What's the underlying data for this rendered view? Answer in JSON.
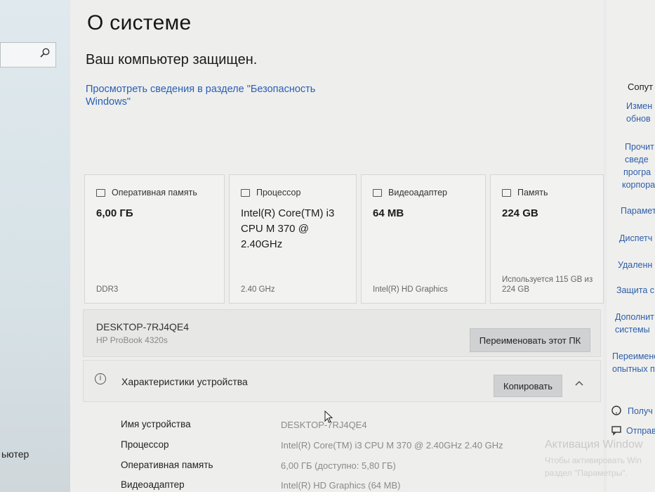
{
  "sidebar": {
    "partial_label": "ьютер"
  },
  "header": {
    "title": "О системе"
  },
  "security": {
    "status": "Ваш компьютер защищен.",
    "link": "Просмотреть сведения в разделе \"Безопасность Windows\""
  },
  "cards": [
    {
      "title": "Оперативная память",
      "icon": "memory-icon",
      "value": "6,00 ГБ",
      "footer": "DDR3"
    },
    {
      "title": "Процессор",
      "icon": "processor-icon",
      "value": "Intel(R) Core(TM) i3 CPU       M 370  @ 2.40GHz",
      "footer": "2.40 GHz"
    },
    {
      "title": "Видеоадаптер",
      "icon": "display-adapter-icon",
      "value": "64 MB",
      "footer": "Intel(R) HD Graphics"
    },
    {
      "title": "Память",
      "icon": "storage-icon",
      "value": "224 GB",
      "footer": "Используется 115 GB из 224 GB"
    }
  ],
  "device": {
    "name": "DESKTOP-7RJ4QE4",
    "model": "HP ProBook 4320s",
    "rename_button": "Переименовать этот ПК"
  },
  "specs": {
    "title": "Характеристики устройства",
    "copy_button": "Копировать",
    "rows": [
      {
        "label": "Имя устройства",
        "value": "DESKTOP-7RJ4QE4"
      },
      {
        "label": "Процессор",
        "value": "Intel(R) Core(TM) i3 CPU       M 370  @ 2.40GHz   2.40 GHz"
      },
      {
        "label": "Оперативная память",
        "value": "6,00 ГБ (доступно: 5,80 ГБ)"
      },
      {
        "label": "Видеоадаптер",
        "value": "Intel(R) HD Graphics (64 MB)"
      }
    ]
  },
  "right_pane": {
    "title": "Сопут",
    "links": [
      "Измен",
      "обнов",
      "Прочит",
      "сведе",
      "програ",
      "корпора",
      "Парамет",
      "Диспетч",
      "Удаленн",
      "Защита с",
      "Дополнит",
      "системы",
      "Переимено",
      "опытных пе",
      "Получ",
      "Отправ"
    ]
  },
  "watermark": {
    "title": "Активация Window",
    "line1": "Чтобы активировать Win",
    "line2": "раздел \"Параметры\"."
  },
  "colors": {
    "link": "#2a5fb3",
    "background": "#eeeeed",
    "button": "#cfd1d2"
  }
}
